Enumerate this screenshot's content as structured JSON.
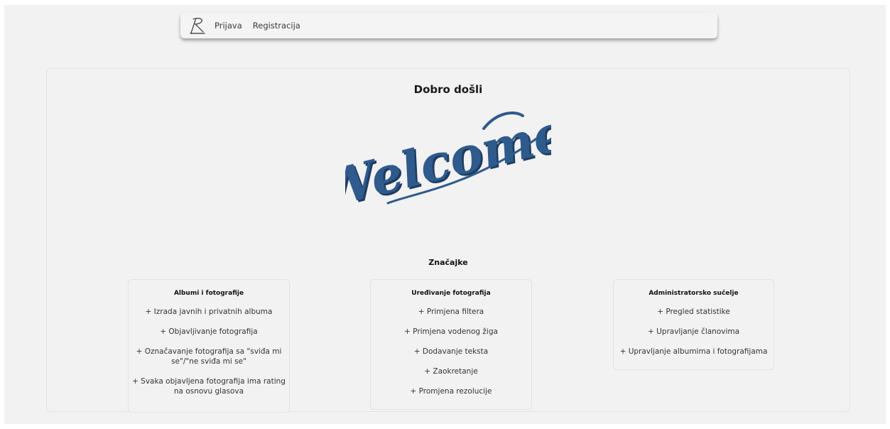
{
  "nav": {
    "links": [
      "Prijava",
      "Registracija"
    ]
  },
  "main": {
    "title": "Dobro došli",
    "welcome_image_text": "Welcome",
    "features_heading": "Značajke",
    "cards": [
      {
        "title": "Albumi i fotografije",
        "items": [
          "+ Izrada javnih i privatnih albuma",
          "+ Objavljivanje fotografija",
          "+ Označavanje fotografija sa \"sviđa mi se\"/\"ne sviđa mi se\"",
          "+ Svaka objavljena fotografija ima rating na osnovu glasova"
        ]
      },
      {
        "title": "Uređivanje fotografija",
        "items": [
          "+ Primjena filtera",
          "+ Primjena vodenog žiga",
          "+ Dodavanje teksta",
          "+ Zaokretanje",
          "+ Promjena rezolucije"
        ]
      },
      {
        "title": "Administratorsko sučelje",
        "items": [
          "+ Pregled statistike",
          "+ Upravljanje članovima",
          "+ Upravljanje albumima i fotografijama"
        ]
      }
    ]
  },
  "colors": {
    "welcome_blue": "#2f5a8c",
    "welcome_shadow": "#1e3c60",
    "background": "#f2f2f2"
  },
  "icons": {
    "logo": "script-r-logo"
  }
}
